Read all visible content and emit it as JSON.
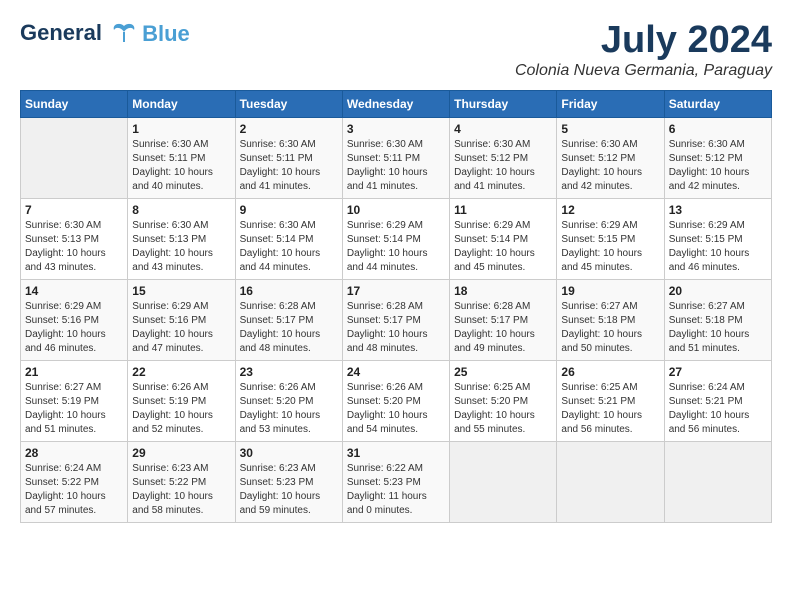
{
  "header": {
    "logo_line1": "General",
    "logo_line2": "Blue",
    "month": "July 2024",
    "location": "Colonia Nueva Germania, Paraguay"
  },
  "days_of_week": [
    "Sunday",
    "Monday",
    "Tuesday",
    "Wednesday",
    "Thursday",
    "Friday",
    "Saturday"
  ],
  "weeks": [
    [
      {
        "day": "",
        "sunrise": "",
        "sunset": "",
        "daylight": ""
      },
      {
        "day": "1",
        "sunrise": "Sunrise: 6:30 AM",
        "sunset": "Sunset: 5:11 PM",
        "daylight": "Daylight: 10 hours and 40 minutes."
      },
      {
        "day": "2",
        "sunrise": "Sunrise: 6:30 AM",
        "sunset": "Sunset: 5:11 PM",
        "daylight": "Daylight: 10 hours and 41 minutes."
      },
      {
        "day": "3",
        "sunrise": "Sunrise: 6:30 AM",
        "sunset": "Sunset: 5:11 PM",
        "daylight": "Daylight: 10 hours and 41 minutes."
      },
      {
        "day": "4",
        "sunrise": "Sunrise: 6:30 AM",
        "sunset": "Sunset: 5:12 PM",
        "daylight": "Daylight: 10 hours and 41 minutes."
      },
      {
        "day": "5",
        "sunrise": "Sunrise: 6:30 AM",
        "sunset": "Sunset: 5:12 PM",
        "daylight": "Daylight: 10 hours and 42 minutes."
      },
      {
        "day": "6",
        "sunrise": "Sunrise: 6:30 AM",
        "sunset": "Sunset: 5:12 PM",
        "daylight": "Daylight: 10 hours and 42 minutes."
      }
    ],
    [
      {
        "day": "7",
        "sunrise": "Sunrise: 6:30 AM",
        "sunset": "Sunset: 5:13 PM",
        "daylight": "Daylight: 10 hours and 43 minutes."
      },
      {
        "day": "8",
        "sunrise": "Sunrise: 6:30 AM",
        "sunset": "Sunset: 5:13 PM",
        "daylight": "Daylight: 10 hours and 43 minutes."
      },
      {
        "day": "9",
        "sunrise": "Sunrise: 6:30 AM",
        "sunset": "Sunset: 5:14 PM",
        "daylight": "Daylight: 10 hours and 44 minutes."
      },
      {
        "day": "10",
        "sunrise": "Sunrise: 6:29 AM",
        "sunset": "Sunset: 5:14 PM",
        "daylight": "Daylight: 10 hours and 44 minutes."
      },
      {
        "day": "11",
        "sunrise": "Sunrise: 6:29 AM",
        "sunset": "Sunset: 5:14 PM",
        "daylight": "Daylight: 10 hours and 45 minutes."
      },
      {
        "day": "12",
        "sunrise": "Sunrise: 6:29 AM",
        "sunset": "Sunset: 5:15 PM",
        "daylight": "Daylight: 10 hours and 45 minutes."
      },
      {
        "day": "13",
        "sunrise": "Sunrise: 6:29 AM",
        "sunset": "Sunset: 5:15 PM",
        "daylight": "Daylight: 10 hours and 46 minutes."
      }
    ],
    [
      {
        "day": "14",
        "sunrise": "Sunrise: 6:29 AM",
        "sunset": "Sunset: 5:16 PM",
        "daylight": "Daylight: 10 hours and 46 minutes."
      },
      {
        "day": "15",
        "sunrise": "Sunrise: 6:29 AM",
        "sunset": "Sunset: 5:16 PM",
        "daylight": "Daylight: 10 hours and 47 minutes."
      },
      {
        "day": "16",
        "sunrise": "Sunrise: 6:28 AM",
        "sunset": "Sunset: 5:17 PM",
        "daylight": "Daylight: 10 hours and 48 minutes."
      },
      {
        "day": "17",
        "sunrise": "Sunrise: 6:28 AM",
        "sunset": "Sunset: 5:17 PM",
        "daylight": "Daylight: 10 hours and 48 minutes."
      },
      {
        "day": "18",
        "sunrise": "Sunrise: 6:28 AM",
        "sunset": "Sunset: 5:17 PM",
        "daylight": "Daylight: 10 hours and 49 minutes."
      },
      {
        "day": "19",
        "sunrise": "Sunrise: 6:27 AM",
        "sunset": "Sunset: 5:18 PM",
        "daylight": "Daylight: 10 hours and 50 minutes."
      },
      {
        "day": "20",
        "sunrise": "Sunrise: 6:27 AM",
        "sunset": "Sunset: 5:18 PM",
        "daylight": "Daylight: 10 hours and 51 minutes."
      }
    ],
    [
      {
        "day": "21",
        "sunrise": "Sunrise: 6:27 AM",
        "sunset": "Sunset: 5:19 PM",
        "daylight": "Daylight: 10 hours and 51 minutes."
      },
      {
        "day": "22",
        "sunrise": "Sunrise: 6:26 AM",
        "sunset": "Sunset: 5:19 PM",
        "daylight": "Daylight: 10 hours and 52 minutes."
      },
      {
        "day": "23",
        "sunrise": "Sunrise: 6:26 AM",
        "sunset": "Sunset: 5:20 PM",
        "daylight": "Daylight: 10 hours and 53 minutes."
      },
      {
        "day": "24",
        "sunrise": "Sunrise: 6:26 AM",
        "sunset": "Sunset: 5:20 PM",
        "daylight": "Daylight: 10 hours and 54 minutes."
      },
      {
        "day": "25",
        "sunrise": "Sunrise: 6:25 AM",
        "sunset": "Sunset: 5:20 PM",
        "daylight": "Daylight: 10 hours and 55 minutes."
      },
      {
        "day": "26",
        "sunrise": "Sunrise: 6:25 AM",
        "sunset": "Sunset: 5:21 PM",
        "daylight": "Daylight: 10 hours and 56 minutes."
      },
      {
        "day": "27",
        "sunrise": "Sunrise: 6:24 AM",
        "sunset": "Sunset: 5:21 PM",
        "daylight": "Daylight: 10 hours and 56 minutes."
      }
    ],
    [
      {
        "day": "28",
        "sunrise": "Sunrise: 6:24 AM",
        "sunset": "Sunset: 5:22 PM",
        "daylight": "Daylight: 10 hours and 57 minutes."
      },
      {
        "day": "29",
        "sunrise": "Sunrise: 6:23 AM",
        "sunset": "Sunset: 5:22 PM",
        "daylight": "Daylight: 10 hours and 58 minutes."
      },
      {
        "day": "30",
        "sunrise": "Sunrise: 6:23 AM",
        "sunset": "Sunset: 5:23 PM",
        "daylight": "Daylight: 10 hours and 59 minutes."
      },
      {
        "day": "31",
        "sunrise": "Sunrise: 6:22 AM",
        "sunset": "Sunset: 5:23 PM",
        "daylight": "Daylight: 11 hours and 0 minutes."
      },
      {
        "day": "",
        "sunrise": "",
        "sunset": "",
        "daylight": ""
      },
      {
        "day": "",
        "sunrise": "",
        "sunset": "",
        "daylight": ""
      },
      {
        "day": "",
        "sunrise": "",
        "sunset": "",
        "daylight": ""
      }
    ]
  ]
}
